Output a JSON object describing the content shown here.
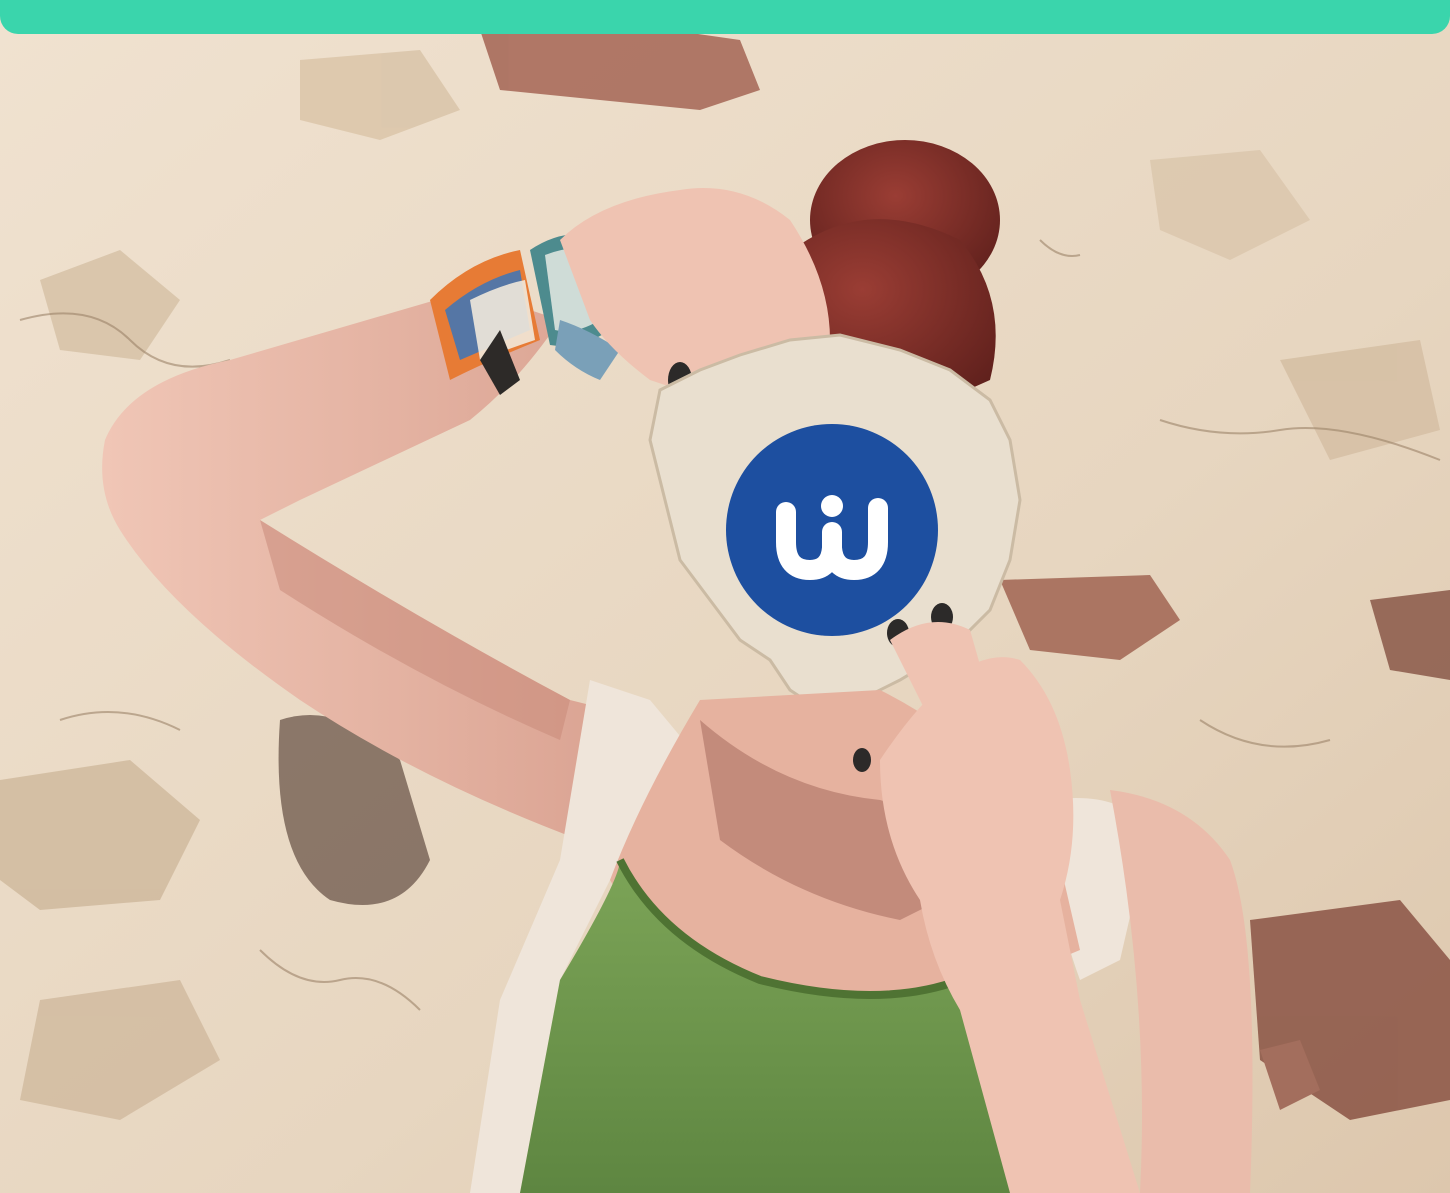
{
  "colors": {
    "top_bar": "#3ad5ac",
    "wall_base": "#ead9c3",
    "wall_shadow": "#d7c1a6",
    "brick": "#a56a57",
    "skin": "#e8b9a8",
    "skin_shadow": "#c98a7a",
    "hair": "#7b2b26",
    "shirt": "#6f964a",
    "shirt_dark": "#4f7333",
    "cardigan": "#efe5da",
    "nails": "#2c2a29",
    "paper": "#e9dfcf",
    "logo_bg": "#1d4fa0",
    "logo_fg": "#ffffff"
  },
  "icons": {
    "logo": "wi-logo-icon"
  }
}
